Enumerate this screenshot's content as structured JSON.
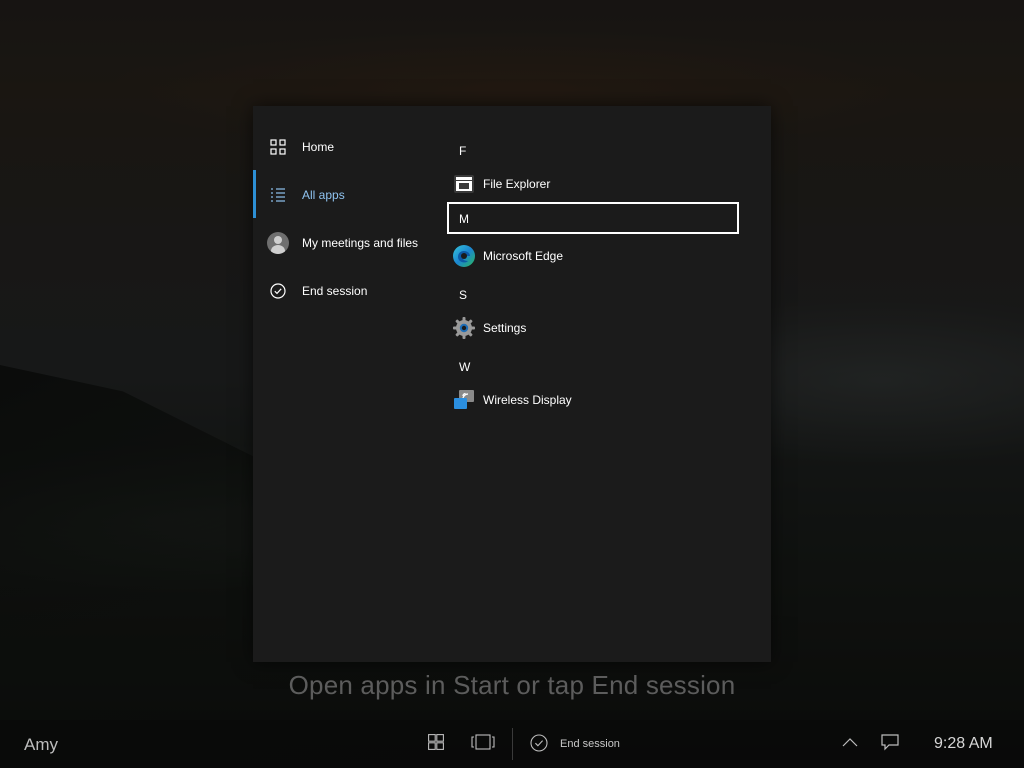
{
  "nav": {
    "items": [
      {
        "label": "Home",
        "icon": "home-icon"
      },
      {
        "label": "All apps",
        "icon": "all-apps-list-icon",
        "selected": true
      },
      {
        "label": "My meetings and files",
        "icon": "avatar-icon"
      },
      {
        "label": "End session",
        "icon": "checkmark-circle-icon"
      }
    ]
  },
  "apps": {
    "groups": [
      {
        "letter": "F",
        "items": [
          {
            "label": "File Explorer",
            "icon": "file-explorer-icon"
          }
        ]
      },
      {
        "letter": "M",
        "items": [
          {
            "label": "Microsoft Edge",
            "icon": "edge-icon"
          }
        ],
        "focused": true
      },
      {
        "letter": "S",
        "items": [
          {
            "label": "Settings",
            "icon": "settings-gear-icon"
          }
        ]
      },
      {
        "letter": "W",
        "items": [
          {
            "label": "Wireless Display",
            "icon": "wireless-display-icon"
          }
        ]
      }
    ]
  },
  "hint": "Open apps in Start or tap End session",
  "taskbar": {
    "user": "Amy",
    "start_icon": "windows-logo-icon",
    "task_view_icon": "task-view-icon",
    "end_session_label": "End session",
    "tray_icon": "chevron-up-icon",
    "notification_icon": "action-center-icon",
    "clock": "9:28 AM"
  },
  "colors": {
    "accent": "#2d8fd5",
    "selected_text": "#8fc3f0",
    "panel": "#1b1b1b"
  }
}
